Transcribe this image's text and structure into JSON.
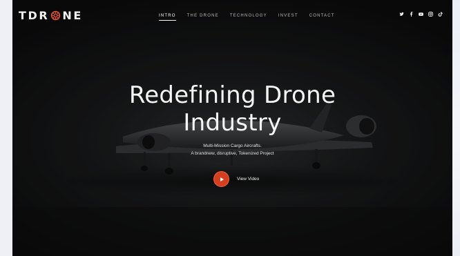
{
  "brand": {
    "logo_left": "TDR",
    "logo_right": "NE",
    "accent": "#d4401f"
  },
  "nav": {
    "items": [
      {
        "label": "INTRO",
        "active": true
      },
      {
        "label": "THE DRONE",
        "active": false
      },
      {
        "label": "TECHNOLOGY",
        "active": false
      },
      {
        "label": "INVEST",
        "active": false
      },
      {
        "label": "CONTACT",
        "active": false
      }
    ]
  },
  "social": [
    "twitter-icon",
    "facebook-icon",
    "youtube-icon",
    "instagram-icon",
    "tiktok-icon"
  ],
  "hero": {
    "headline_line1": "Redefining Drone",
    "headline_line2": "Industry",
    "sub_line1": "Multi-Mission Cargo Aircrafts.",
    "sub_line2": "A brandnew, disruptive, Tokenized Project",
    "video_label": "View Video"
  }
}
